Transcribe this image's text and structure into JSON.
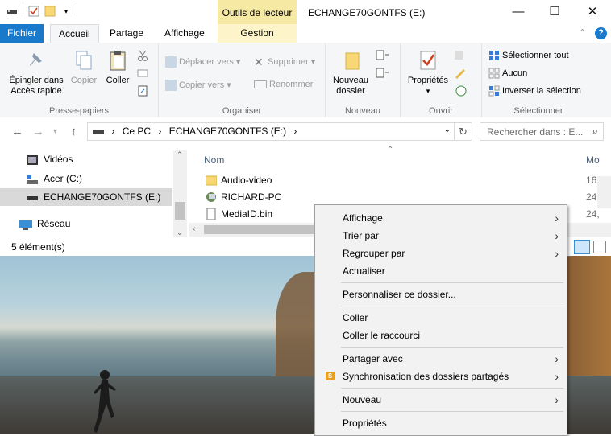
{
  "window": {
    "title": "ECHANGE70GONTFS (E:)",
    "contextual_tab_group": "Outils de lecteur",
    "controls": {
      "minimize": "—",
      "maximize": "☐",
      "close": "✕"
    }
  },
  "ribbon_tabs": [
    "Fichier",
    "Accueil",
    "Partage",
    "Affichage",
    "Gestion"
  ],
  "ribbon": {
    "presse_papiers": {
      "label": "Presse-papiers",
      "epingler": "Épingler dans Accès rapide",
      "copier": "Copier",
      "coller": "Coller"
    },
    "organiser": {
      "label": "Organiser",
      "deplacer_vers": "Déplacer vers",
      "copier_vers": "Copier vers",
      "supprimer": "Supprimer",
      "renommer": "Renommer"
    },
    "nouveau": {
      "label": "Nouveau",
      "nouveau_dossier": "Nouveau dossier"
    },
    "ouvrir": {
      "label": "Ouvrir",
      "proprietes": "Propriétés"
    },
    "selectionner": {
      "label": "Sélectionner",
      "selectionner_tout": "Sélectionner tout",
      "aucun": "Aucun",
      "inverser": "Inverser la sélection"
    }
  },
  "address": {
    "crumbs": [
      "Ce PC",
      "ECHANGE70GONTFS (E:)"
    ],
    "search_placeholder": "Rechercher dans : E..."
  },
  "nav_pane": [
    {
      "label": "Vidéos",
      "icon": "video-icon"
    },
    {
      "label": "Acer (C:)",
      "icon": "drive-icon"
    },
    {
      "label": "ECHANGE70GONTFS (E:)",
      "icon": "drive-icon",
      "selected": true
    },
    {
      "label": "Réseau",
      "icon": "network-icon"
    }
  ],
  "file_list": {
    "column": "Nom",
    "column2_partial": "Mo",
    "items": [
      {
        "name": "Audio-video",
        "icon": "folder-icon",
        "date_partial": "16,"
      },
      {
        "name": "RICHARD-PC",
        "icon": "computer-icon",
        "date_partial": "24,"
      },
      {
        "name": "MediaID.bin",
        "icon": "file-icon",
        "date_partial": "24,"
      }
    ]
  },
  "status": "5 élément(s)",
  "context_menu": [
    {
      "label": "Affichage",
      "submenu": true
    },
    {
      "label": "Trier par",
      "submenu": true
    },
    {
      "label": "Regrouper par",
      "submenu": true
    },
    {
      "label": "Actualiser",
      "submenu": false
    },
    {
      "label": "Personnaliser ce dossier...",
      "submenu": false
    },
    {
      "label": "Coller",
      "submenu": false
    },
    {
      "label": "Coller le raccourci",
      "submenu": false
    },
    {
      "label": "Partager avec",
      "submenu": true
    },
    {
      "label": "Synchronisation des dossiers partagés",
      "submenu": true
    },
    {
      "label": "Nouveau",
      "submenu": true
    },
    {
      "label": "Propriétés",
      "submenu": false
    }
  ],
  "colors": {
    "accent": "#1979ca",
    "context_tab": "#f6e9a3",
    "selection": "#d9d9d9"
  }
}
